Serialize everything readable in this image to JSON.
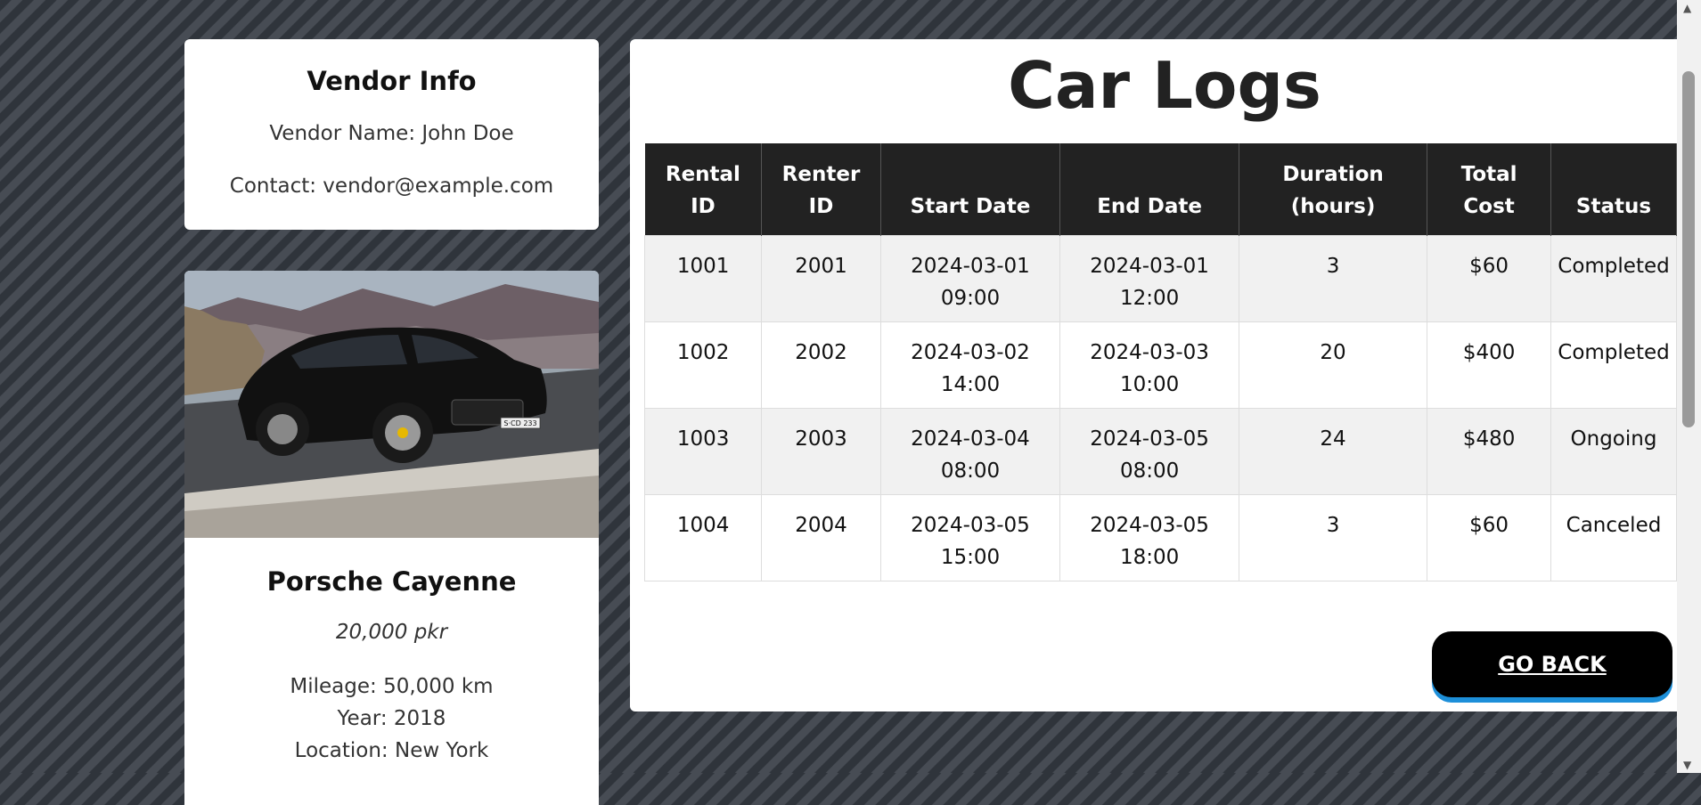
{
  "vendor": {
    "title": "Vendor Info",
    "name_text": "Vendor Name: John Doe",
    "contact_text": "Contact: vendor@example.com"
  },
  "car": {
    "name": "Porsche Cayenne",
    "price": "20,000 pkr",
    "mileage_text": "Mileage: 50,000 km",
    "year_text": "Year: 2018",
    "location_text": "Location: New York",
    "plate_text": "S·CD 233"
  },
  "logs": {
    "title": "Car Logs",
    "headers": [
      "Rental ID",
      "Renter ID",
      "Start Date",
      "End Date",
      "Duration (hours)",
      "Total Cost",
      "Status"
    ],
    "rows": [
      [
        "1001",
        "2001",
        "2024-03-01 09:00",
        "2024-03-01 12:00",
        "3",
        "$60",
        "Completed"
      ],
      [
        "1002",
        "2002",
        "2024-03-02 14:00",
        "2024-03-03 10:00",
        "20",
        "$400",
        "Completed"
      ],
      [
        "1003",
        "2003",
        "2024-03-04 08:00",
        "2024-03-05 08:00",
        "24",
        "$480",
        "Ongoing"
      ],
      [
        "1004",
        "2004",
        "2024-03-05 15:00",
        "2024-03-05 18:00",
        "3",
        "$60",
        "Canceled"
      ]
    ]
  },
  "actions": {
    "go_back_label": "GO BACK"
  },
  "colors": {
    "table_header_bg": "#222222",
    "button_bg": "#000000",
    "button_accent": "#1d8fd9"
  }
}
